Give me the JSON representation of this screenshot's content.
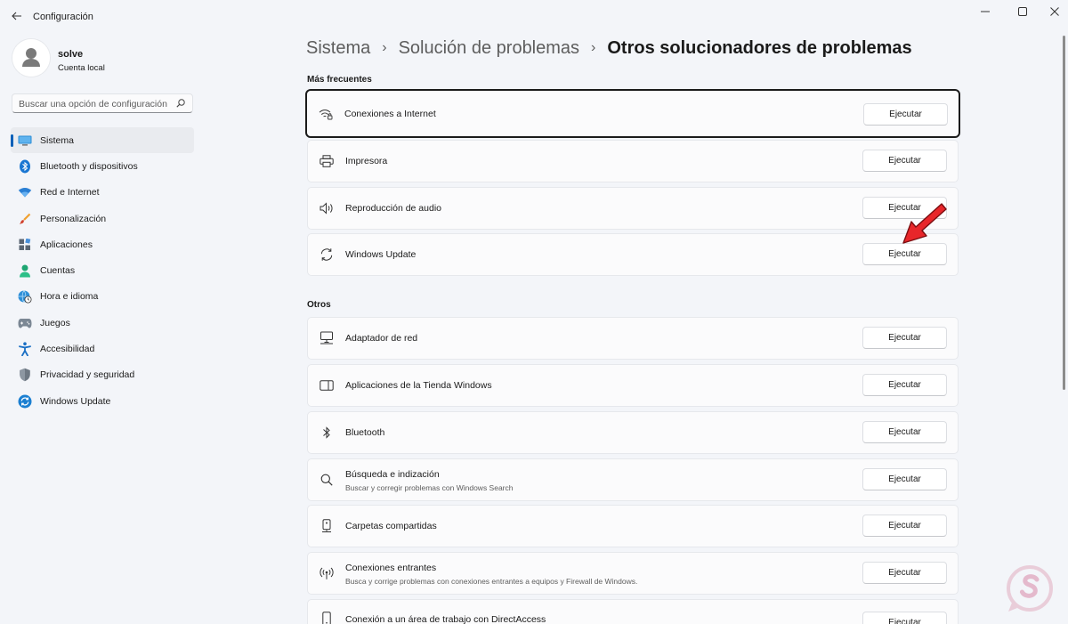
{
  "window": {
    "title": "Configuración",
    "controls": [
      "minimize",
      "maximize",
      "close"
    ]
  },
  "profile": {
    "name": "solve",
    "account_type": "Cuenta local"
  },
  "search": {
    "placeholder": "Buscar una opción de configuración"
  },
  "nav": {
    "items": [
      {
        "label": "Sistema",
        "icon": "monitor-icon",
        "active": true
      },
      {
        "label": "Bluetooth y dispositivos",
        "icon": "bluetooth-icon"
      },
      {
        "label": "Red e Internet",
        "icon": "wifi-icon"
      },
      {
        "label": "Personalización",
        "icon": "brush-icon"
      },
      {
        "label": "Aplicaciones",
        "icon": "apps-icon"
      },
      {
        "label": "Cuentas",
        "icon": "person-icon"
      },
      {
        "label": "Hora e idioma",
        "icon": "globe-clock-icon"
      },
      {
        "label": "Juegos",
        "icon": "gamepad-icon"
      },
      {
        "label": "Accesibilidad",
        "icon": "accessibility-icon"
      },
      {
        "label": "Privacidad y seguridad",
        "icon": "shield-icon"
      },
      {
        "label": "Windows Update",
        "icon": "update-icon"
      }
    ]
  },
  "breadcrumb": {
    "items": [
      "Sistema",
      "Solución de problemas"
    ],
    "current": "Otros solucionadores de problemas",
    "separator": "›"
  },
  "sections": {
    "frequent": {
      "title": "Más frecuentes",
      "items": [
        {
          "title": "Conexiones a Internet",
          "icon": "wifi-lock-icon",
          "button": "Ejecutar"
        },
        {
          "title": "Impresora",
          "icon": "printer-icon",
          "button": "Ejecutar"
        },
        {
          "title": "Reproducción de audio",
          "icon": "speaker-icon",
          "button": "Ejecutar"
        },
        {
          "title": "Windows Update",
          "icon": "sync-icon",
          "button": "Ejecutar"
        }
      ]
    },
    "others": {
      "title": "Otros",
      "items": [
        {
          "title": "Adaptador de red",
          "icon": "network-adapter-icon",
          "button": "Ejecutar"
        },
        {
          "title": "Aplicaciones de la Tienda Windows",
          "icon": "store-app-icon",
          "button": "Ejecutar"
        },
        {
          "title": "Bluetooth",
          "icon": "bluetooth-icon",
          "button": "Ejecutar"
        },
        {
          "title": "Búsqueda e indización",
          "subtitle": "Buscar y corregir problemas con Windows Search",
          "icon": "search-icon",
          "button": "Ejecutar"
        },
        {
          "title": "Carpetas compartidas",
          "icon": "shared-folder-icon",
          "button": "Ejecutar"
        },
        {
          "title": "Conexiones entrantes",
          "subtitle": "Busca y corrige problemas con conexiones entrantes a equipos y Firewall de Windows.",
          "icon": "incoming-connection-icon",
          "button": "Ejecutar"
        },
        {
          "title": "Conexión a un área de trabajo con DirectAccess",
          "icon": "phone-device-icon",
          "button": "Ejecutar"
        }
      ]
    }
  },
  "colors": {
    "background": "#f3f5f9",
    "card": "#fbfbfc",
    "accent": "#005fb8",
    "annotation_arrow": "#e8262a"
  }
}
